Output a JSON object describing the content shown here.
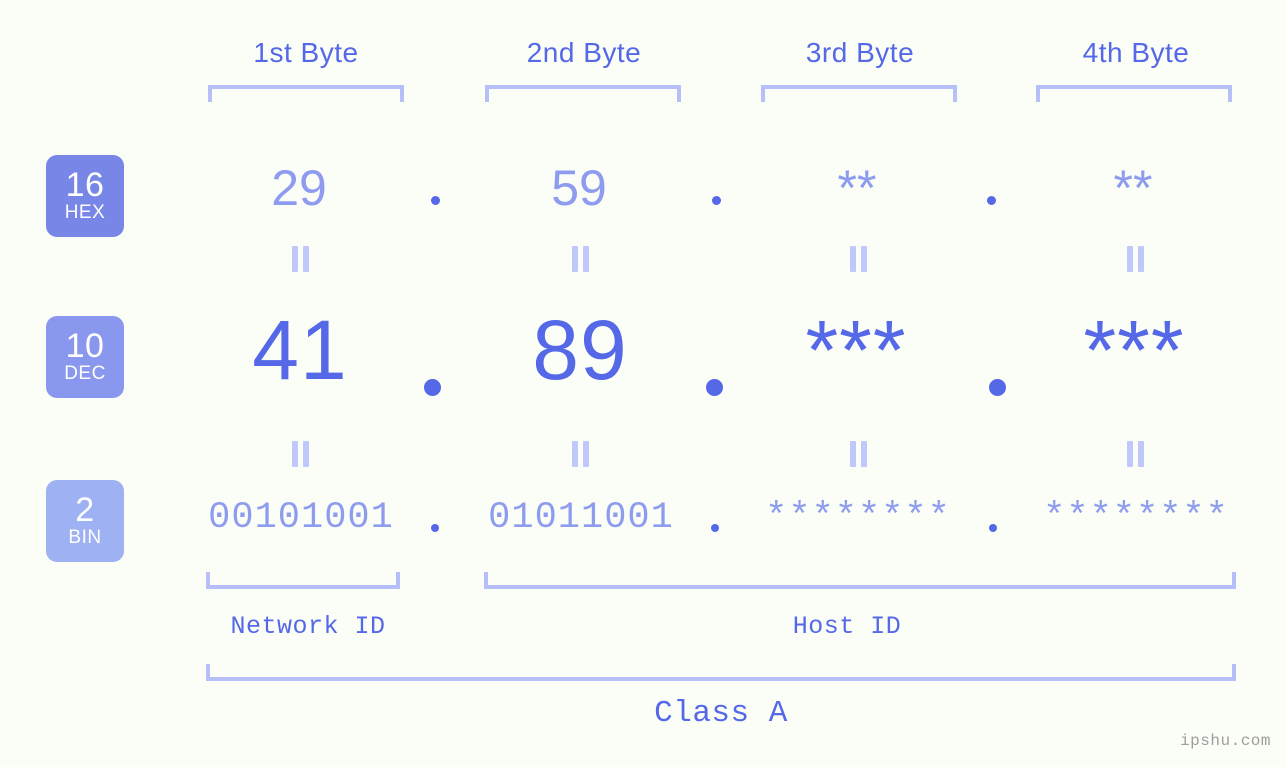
{
  "meta": {
    "background_color": "#fbfdf7",
    "accent_color": "#5468e8",
    "light_accent_color": "#8e9cef",
    "bracket_color": "#b7bffa",
    "watermark": "ipshu.com"
  },
  "headers": {
    "bytes": [
      {
        "label": "1st Byte"
      },
      {
        "label": "2nd Byte"
      },
      {
        "label": "3rd Byte"
      },
      {
        "label": "4th Byte"
      }
    ]
  },
  "bases": [
    {
      "number": "16",
      "name": "HEX",
      "color": "#7886e8"
    },
    {
      "number": "10",
      "name": "DEC",
      "color": "#8a97ee"
    },
    {
      "number": "2",
      "name": "BIN",
      "color": "#9db1f3"
    }
  ],
  "rows": {
    "hex": {
      "base_number": "16",
      "base_name": "HEX",
      "values": [
        "29",
        "59",
        "**",
        "**"
      ],
      "separator": "."
    },
    "dec": {
      "base_number": "10",
      "base_name": "DEC",
      "values": [
        "41",
        "89",
        "***",
        "***"
      ],
      "separator": "."
    },
    "bin": {
      "base_number": "2",
      "base_name": "BIN",
      "values": [
        "00101001",
        "01011001",
        "********",
        "********"
      ],
      "separator": "."
    }
  },
  "equality_marks": {
    "symbol": "=",
    "count_per_row": 4
  },
  "regions": {
    "network_id": "Network ID",
    "host_id": "Host ID",
    "class": "Class A"
  }
}
